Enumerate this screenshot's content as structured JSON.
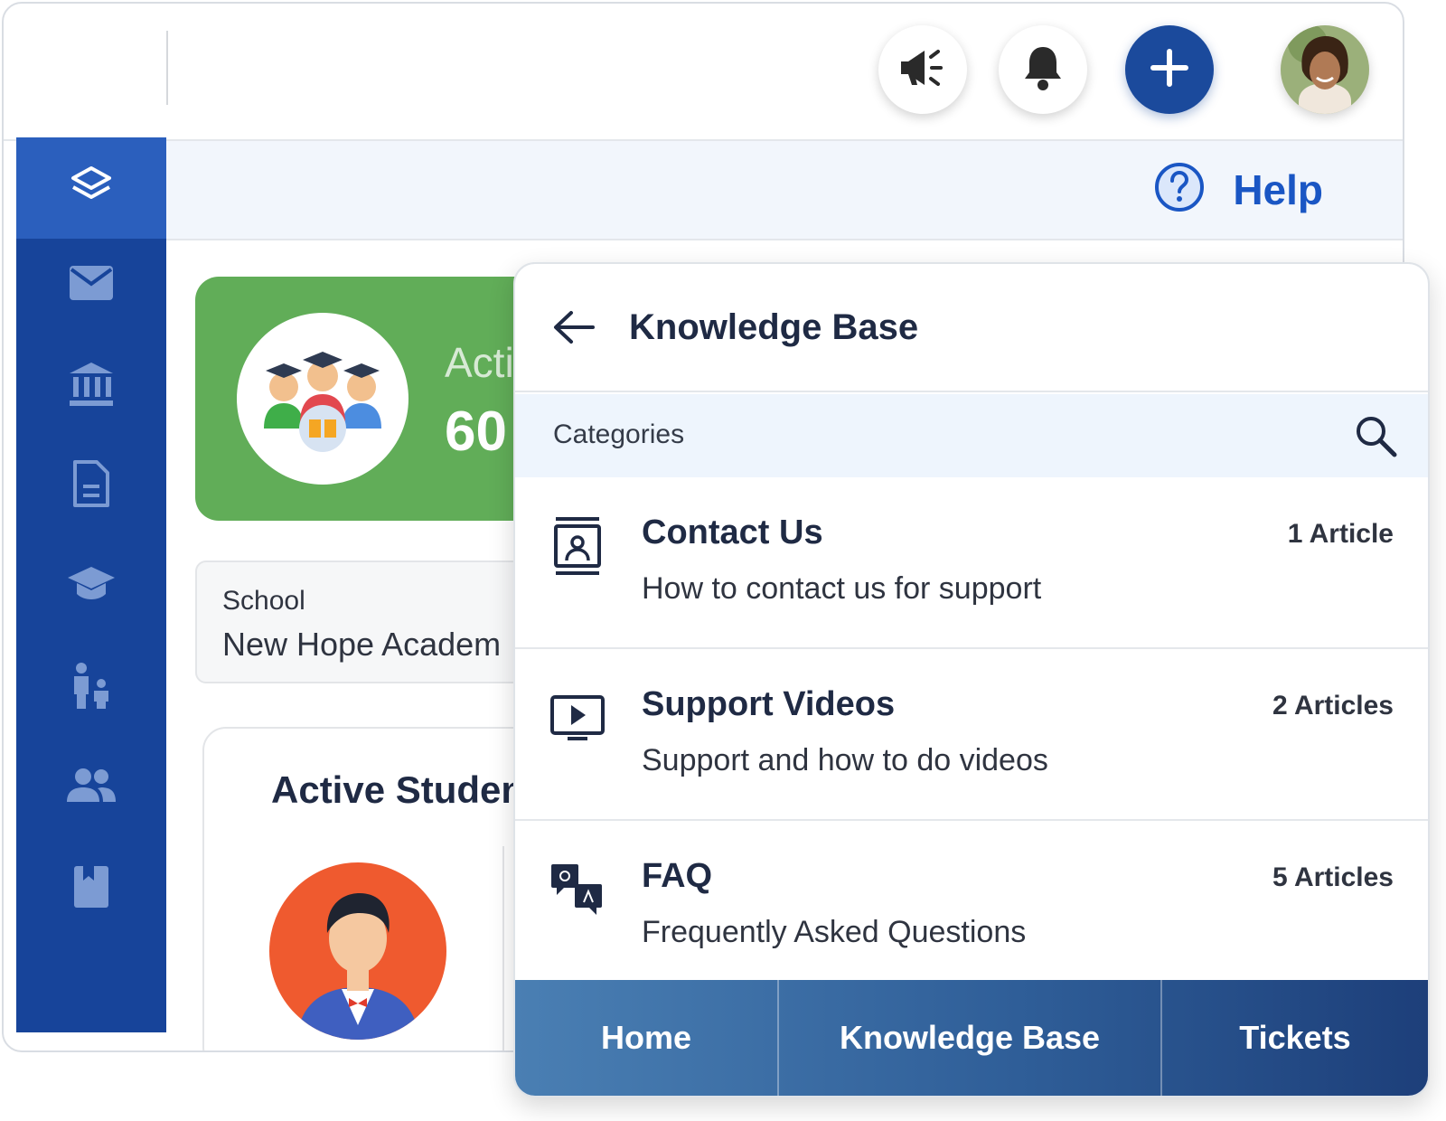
{
  "topbar": {
    "buttons": [
      {
        "icon": "megaphone-icon"
      },
      {
        "icon": "bell-icon"
      },
      {
        "icon": "plus-icon"
      }
    ],
    "avatar": "user-avatar"
  },
  "sidebar": {
    "items": [
      {
        "icon": "layers-icon",
        "active": true
      },
      {
        "icon": "mail-icon"
      },
      {
        "icon": "bank-icon"
      },
      {
        "icon": "document-icon"
      },
      {
        "icon": "graduation-cap-icon"
      },
      {
        "icon": "parent-child-icon"
      },
      {
        "icon": "users-icon"
      },
      {
        "icon": "book-icon"
      }
    ]
  },
  "help": {
    "label": "Help",
    "icon": "question-circle-icon"
  },
  "dashboard": {
    "active_card": {
      "label": "Acti",
      "value": "60"
    },
    "school": {
      "label": "School",
      "value": "New Hope Academ"
    },
    "students_title": "Active Studen"
  },
  "knowledge_base": {
    "title": "Knowledge Base",
    "categories_label": "Categories",
    "items": [
      {
        "title": "Contact Us",
        "description": "How to contact us for support",
        "count": "1 Article",
        "icon": "contact-card-icon"
      },
      {
        "title": "Support Videos",
        "description": "Support and how to do videos",
        "count": "2 Articles",
        "icon": "video-play-icon"
      },
      {
        "title": "FAQ",
        "description": "Frequently Asked Questions",
        "count": "5 Articles",
        "icon": "qa-chat-icon"
      }
    ],
    "tabs": [
      "Home",
      "Knowledge Base",
      "Tickets"
    ]
  },
  "colors": {
    "sidebar": "#17449a",
    "sidebar_active": "#2b5fbd",
    "accent": "#1b4a9c",
    "help_link": "#1a56c4",
    "active_card": "#61ad58"
  }
}
